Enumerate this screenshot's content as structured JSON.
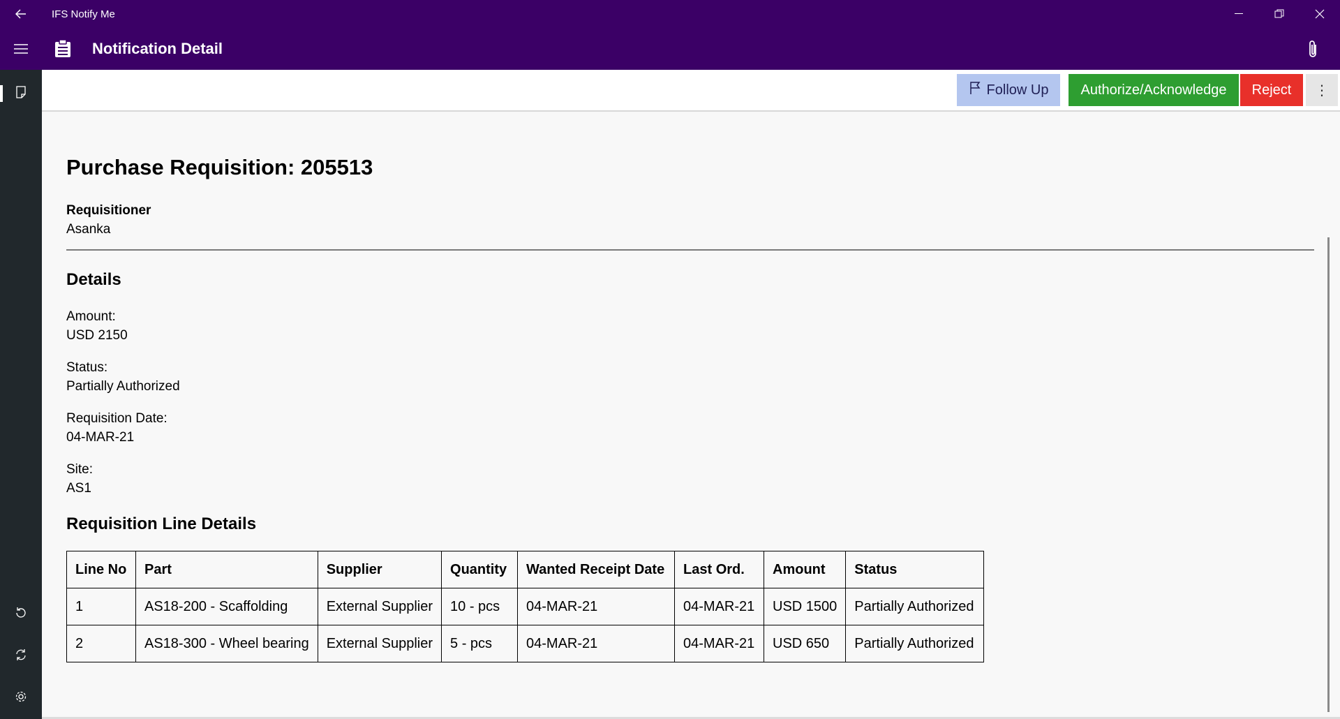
{
  "window": {
    "app_title": "IFS Notify Me"
  },
  "header": {
    "page_title": "Notification Detail"
  },
  "commands": {
    "follow_up": "Follow Up",
    "authorize": "Authorize/Acknowledge",
    "reject": "Reject",
    "more": "⋮"
  },
  "colors": {
    "title_bar": "#3b0066",
    "sidebar": "#21282c",
    "follow_up_bg": "#b4c6ef",
    "authorize_bg": "#2e9e31",
    "reject_bg": "#e8302a"
  },
  "requisition": {
    "title": "Purchase Requisition: 205513",
    "requisitioner_label": "Requisitioner",
    "requisitioner_value": "Asanka",
    "details_title": "Details",
    "fields": [
      {
        "label": "Amount:",
        "value": "USD 2150"
      },
      {
        "label": "Status:",
        "value": "Partially Authorized"
      },
      {
        "label": "Requisition Date:",
        "value": "04-MAR-21"
      },
      {
        "label": "Site:",
        "value": "AS1"
      }
    ],
    "lines_title": "Requisition Line Details",
    "columns": [
      "Line No",
      "Part",
      "Supplier",
      "Quantity",
      "Wanted Receipt Date",
      "Last Ord.",
      "Amount",
      "Status"
    ],
    "rows": [
      [
        "1",
        "AS18-200 - Scaffolding",
        "External Supplier",
        "10 - pcs",
        "04-MAR-21",
        "04-MAR-21",
        "USD 1500",
        "Partially Authorized"
      ],
      [
        "2",
        "AS18-300 - Wheel bearing",
        "External Supplier",
        "5 - pcs",
        "04-MAR-21",
        "04-MAR-21",
        "USD 650",
        "Partially Authorized"
      ]
    ]
  }
}
